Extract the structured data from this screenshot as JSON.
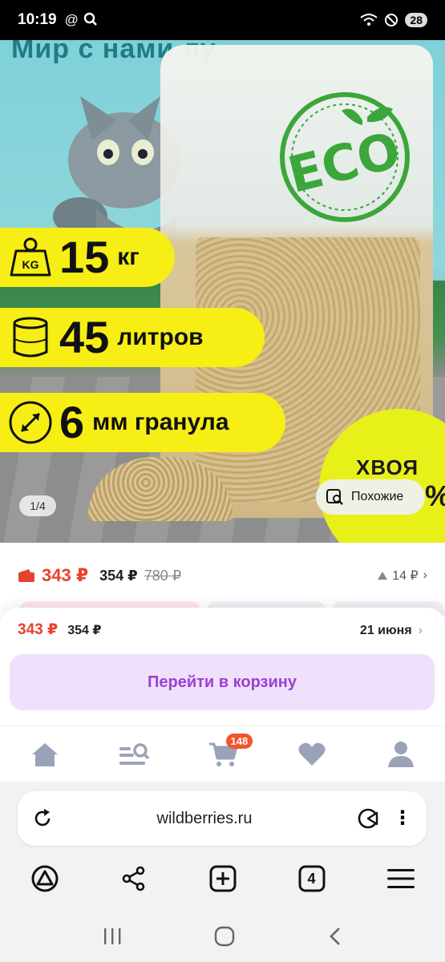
{
  "status_bar": {
    "time": "10:19",
    "battery": "28"
  },
  "hero": {
    "tagline": "Мир с нами лу",
    "features": [
      {
        "icon": "weight-icon",
        "icon_text": "KG",
        "value": "15",
        "unit": "кг"
      },
      {
        "icon": "cylinder-icon",
        "value": "45",
        "unit": "литров"
      },
      {
        "icon": "diagonal-arrow-icon",
        "value": "6",
        "unit": "мм гранула"
      }
    ],
    "eco_logo_text": "ECO",
    "badge_text": "ХВОЯ",
    "badge_pct": "%",
    "image_counter": "1/4",
    "similar_label": "Похожие"
  },
  "price_row": {
    "main_price": "343 ₽",
    "second_price": "354 ₽",
    "old_price": "780 ₽",
    "delta": "14 ₽"
  },
  "sheet": {
    "price": "343 ₽",
    "second_price": "354 ₽",
    "delivery_date": "21 июня",
    "cart_button": "Перейти в корзину"
  },
  "app_nav": {
    "items": [
      "home-icon",
      "catalog-search-icon",
      "cart-icon",
      "heart-icon",
      "profile-icon"
    ],
    "cart_count": "148"
  },
  "browser": {
    "url": "wildberries.ru",
    "tab_count": "4"
  },
  "colors": {
    "accent": "#9b3fd4",
    "price_red": "#e8412e",
    "yellow": "#f6ee14",
    "nav_icon": "#9aa2b8"
  }
}
